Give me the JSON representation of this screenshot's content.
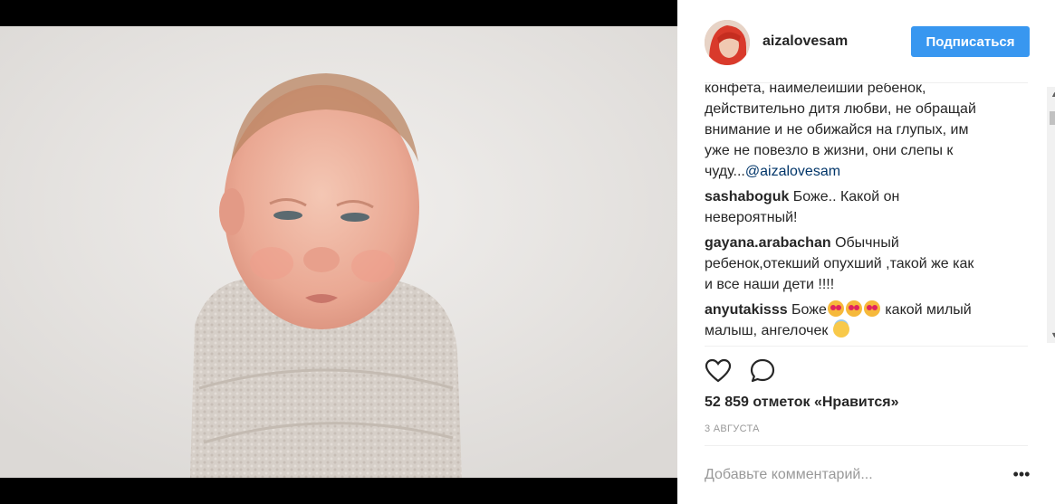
{
  "post": {
    "username": "aizalovesam",
    "follow_label": "Подписаться",
    "caption_lines": [
      "конфета, наимелеишии ребенок,",
      "действительно дитя любви, не обращай",
      "внимание и не обижайся на глупых, им",
      "уже не повезло в жизни, они слепы к",
      "чуду..."
    ],
    "caption_mention": "@aizalovesam",
    "comments": [
      {
        "user": "sashaboguk",
        "line1": " Боже.. Какой он",
        "line2": "невероятный!"
      },
      {
        "user": "gayana.arabachan",
        "line1": " Обычный",
        "line2": "ребенок,отекший опухший ,такой же как",
        "line3": "и все наши дети !!!!"
      },
      {
        "user": "anyutakisss",
        "line1a": " Боже",
        "line1b": " какой милый",
        "line2": "малыш, ангелочек",
        "emoji_1": "heart-eyes-emoji",
        "emoji_2": "angel-emoji"
      }
    ],
    "likes": "52 859 отметок «Нравится»",
    "date": "3 АВГУСТА",
    "add_comment_placeholder": "Добавьте комментарий...",
    "more_label": "•••"
  },
  "icons": {
    "like": "heart-outline-icon",
    "comment": "speech-bubble-icon"
  },
  "colors": {
    "accent": "#3897f0",
    "text": "#262626",
    "muted": "#999999",
    "mention": "#003569"
  }
}
